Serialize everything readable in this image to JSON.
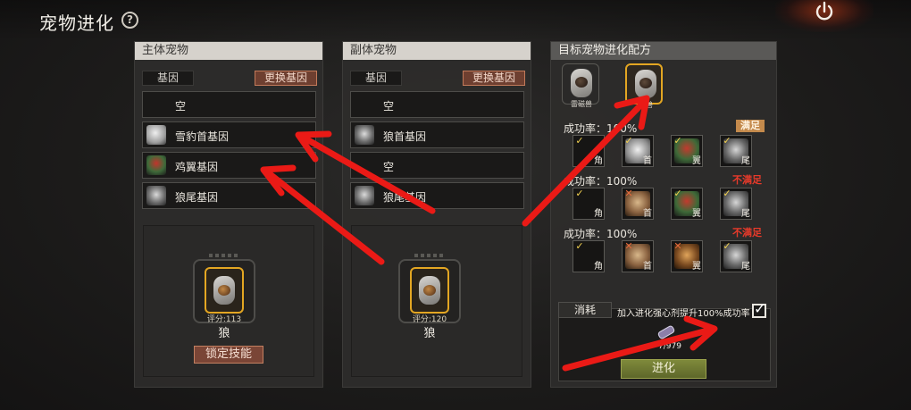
{
  "header": {
    "title": "宠物进化",
    "help_icon": "?"
  },
  "main_pet": {
    "title": "主体宠物",
    "gene_label": "基因",
    "swap_label": "更换基因",
    "genes": [
      {
        "label": "空",
        "icon": null
      },
      {
        "label": "雪豹首基因",
        "icon": "snow-leopard-head-icon"
      },
      {
        "label": "鸡翼基因",
        "icon": "chicken-wing-icon"
      },
      {
        "label": "狼尾基因",
        "icon": "wolf-tail-icon"
      }
    ],
    "score": "评分:113",
    "name": "狼",
    "lock_label": "锁定技能"
  },
  "sub_pet": {
    "title": "副体宠物",
    "gene_label": "基因",
    "swap_label": "更换基因",
    "genes": [
      {
        "label": "空",
        "icon": null
      },
      {
        "label": "狼首基因",
        "icon": "wolf-head-icon"
      },
      {
        "label": "空",
        "icon": null
      },
      {
        "label": "狼尾基因",
        "icon": "wolf-tail-icon"
      }
    ],
    "score": "评分:120",
    "name": "狼"
  },
  "recipe": {
    "title": "目标宠物进化配方",
    "targets": [
      {
        "name": "雷磁兽",
        "selected": false
      },
      {
        "name": "翼兽",
        "selected": true
      }
    ],
    "rows": [
      {
        "rate": "成功率：100%",
        "status": "满足",
        "ok": true,
        "slots": [
          {
            "cap": "角",
            "mark": "✓",
            "portrait": null
          },
          {
            "cap": "首",
            "mark": "✓",
            "portrait": "snow-leopard"
          },
          {
            "cap": "翼",
            "mark": "✓",
            "portrait": "chicken"
          },
          {
            "cap": "尾",
            "mark": "✓",
            "portrait": "wolf"
          }
        ]
      },
      {
        "rate": "成功率：100%",
        "status": "不满足",
        "ok": false,
        "slots": [
          {
            "cap": "角",
            "mark": "✓",
            "portrait": null
          },
          {
            "cap": "首",
            "mark": "✕",
            "portrait": "dog"
          },
          {
            "cap": "翼",
            "mark": "✓",
            "portrait": "chicken"
          },
          {
            "cap": "尾",
            "mark": "✓",
            "portrait": "wolf"
          }
        ]
      },
      {
        "rate": "成功率：100%",
        "status": "不满足",
        "ok": false,
        "slots": [
          {
            "cap": "角",
            "mark": "✓",
            "portrait": null
          },
          {
            "cap": "首",
            "mark": "✕",
            "portrait": "dog"
          },
          {
            "cap": "翼",
            "mark": "✕",
            "portrait": "eagle"
          },
          {
            "cap": "尾",
            "mark": "✓",
            "portrait": "wolf"
          }
        ]
      }
    ],
    "consume_label": "消耗",
    "boost_label": "加入进化强心剂提升100%成功率",
    "boost_checked": true,
    "item_count": "7/979",
    "evolve_label": "进化"
  },
  "colors": {
    "accent_orange": "#e3a622",
    "arrow_red": "#ea1a16",
    "status_ok": "#c48a4c",
    "status_no": "#e83a2a"
  }
}
